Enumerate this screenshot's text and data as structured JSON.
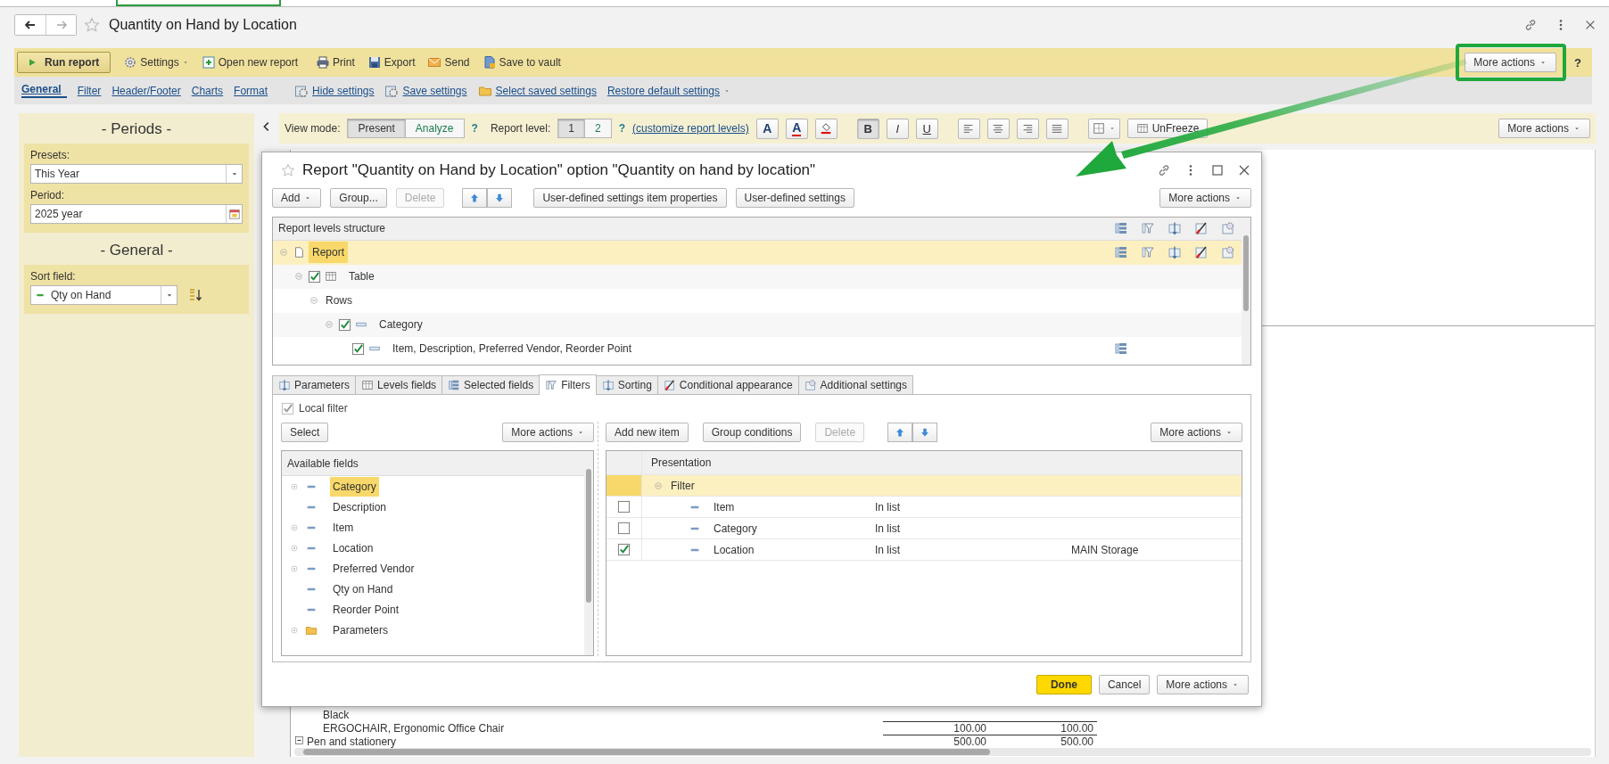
{
  "window": {
    "title": "Quantity on Hand by Location"
  },
  "command_bar": {
    "run_button": "Run report",
    "items": [
      {
        "label": "Settings",
        "dropdown": true
      },
      {
        "label": "Open new report",
        "dropdown": false
      },
      {
        "label": "Print",
        "dropdown": false
      },
      {
        "label": "Export",
        "dropdown": false
      },
      {
        "label": "Send",
        "dropdown": false
      },
      {
        "label": "Save to vault",
        "dropdown": false
      }
    ],
    "more_actions": {
      "label": "More actions",
      "highlighted": true
    },
    "help": "?"
  },
  "settings_bar": {
    "tabs": [
      {
        "label": "General",
        "selected": true
      },
      {
        "label": "Filter",
        "selected": false
      },
      {
        "label": "Header/Footer",
        "selected": false
      },
      {
        "label": "Charts",
        "selected": false
      },
      {
        "label": "Format",
        "selected": false
      }
    ],
    "links": [
      {
        "label": "Hide settings",
        "dropdown": false
      },
      {
        "label": "Save settings",
        "dropdown": false
      },
      {
        "label": "Select saved settings",
        "dropdown": false
      },
      {
        "label": "Restore default settings",
        "dropdown": true
      }
    ]
  },
  "settings_panel": {
    "sections": [
      {
        "title": "- Periods -",
        "fields": [
          {
            "kind": "select",
            "label": "Presets:",
            "value": "This Year"
          },
          {
            "kind": "date",
            "label": "Period:",
            "value": "2025 year"
          }
        ]
      },
      {
        "title": "- General -",
        "fields": [
          {
            "kind": "sort",
            "label": "Sort field:",
            "value": "Qty on Hand"
          }
        ]
      }
    ]
  },
  "report_toolbar": {
    "view_mode_label": "View mode:",
    "view_modes": [
      {
        "label": "Present",
        "selected": true
      },
      {
        "label": "Analyze",
        "selected": false
      }
    ],
    "view_mode_help": "?",
    "level_label": "Report level:",
    "levels": [
      {
        "label": "1",
        "selected": true
      },
      {
        "label": "2",
        "selected": false
      }
    ],
    "level_help": "?",
    "customize_link": "(customize report levels)",
    "font_buttons": [
      "A",
      "A"
    ],
    "style_buttons": [
      {
        "label": "B",
        "selected": true
      },
      {
        "label": "I",
        "selected": false
      },
      {
        "label": "U",
        "selected": false
      }
    ],
    "unfreeze": "UnFreeze",
    "more_actions": "More actions"
  },
  "report": {
    "rows": [
      {
        "kind": "text",
        "label": "Black"
      },
      {
        "kind": "item",
        "label": "ERGOCHAIR, Ergonomic Office Chair",
        "values": [
          "100.00",
          "100.00"
        ]
      },
      {
        "kind": "group",
        "label": "Pen and stationery",
        "values": [
          "500.00",
          "500.00"
        ]
      }
    ]
  },
  "dialog": {
    "title": "Report \"Quantity on Hand by Location\" option \"Quantity on hand by location\"",
    "buttons": [
      {
        "label": "Add",
        "dropdown": true,
        "disabled": false
      },
      {
        "label": "Group...",
        "dropdown": false,
        "disabled": false
      },
      {
        "label": "Delete",
        "dropdown": false,
        "disabled": true
      }
    ],
    "setting_buttons": [
      "User-defined settings item properties",
      "User-defined settings"
    ],
    "more_actions": "More actions",
    "structure": {
      "header": "Report levels structure",
      "items": [
        {
          "kind": "report",
          "label": "Report",
          "selected": true,
          "expanded": true,
          "children": [
            {
              "kind": "table",
              "label": "Table",
              "checked": true,
              "selected": false,
              "expanded": true,
              "children": [
                {
                  "kind": "rows",
                  "label": "Rows",
                  "selected": false,
                  "expanded": true,
                  "children": [
                    {
                      "kind": "group",
                      "label": "Category",
                      "checked": true,
                      "selected": false,
                      "expanded": true,
                      "children": [
                        {
                          "kind": "detail",
                          "label": "Item, Description, Preferred Vendor, Reorder Point",
                          "checked": true,
                          "selected": false
                        }
                      ]
                    }
                  ]
                }
              ]
            }
          ]
        }
      ]
    },
    "tabs": [
      {
        "label": "Parameters",
        "selected": false
      },
      {
        "label": "Levels fields",
        "selected": false
      },
      {
        "label": "Selected fields",
        "selected": false
      },
      {
        "label": "Filters",
        "selected": true
      },
      {
        "label": "Sorting",
        "selected": false
      },
      {
        "label": "Conditional appearance",
        "selected": false
      },
      {
        "label": "Additional settings",
        "selected": false
      }
    ],
    "local_filter": {
      "label": "Local filter",
      "checked": true
    },
    "select_button": "Select",
    "fields_more_actions": "More actions",
    "available_fields": {
      "header": "Available fields",
      "items": [
        {
          "kind": "field",
          "label": "Category",
          "expandable": true,
          "selected": true
        },
        {
          "kind": "field",
          "label": "Description",
          "expandable": false,
          "selected": false
        },
        {
          "kind": "field",
          "label": "Item",
          "expandable": true,
          "selected": false
        },
        {
          "kind": "field",
          "label": "Location",
          "expandable": true,
          "selected": false
        },
        {
          "kind": "field",
          "label": "Preferred Vendor",
          "expandable": true,
          "selected": false
        },
        {
          "kind": "field",
          "label": "Qty on Hand",
          "expandable": false,
          "selected": false
        },
        {
          "kind": "field",
          "label": "Reorder Point",
          "expandable": false,
          "selected": false
        },
        {
          "kind": "folder",
          "label": "Parameters",
          "expandable": true,
          "selected": false
        }
      ]
    },
    "filter_buttons": [
      {
        "label": "Add new item",
        "disabled": false
      },
      {
        "label": "Group conditions",
        "disabled": false
      },
      {
        "label": "Delete",
        "disabled": true
      }
    ],
    "filter_more_actions": "More actions",
    "filter_table": {
      "header": "Presentation",
      "rows": [
        {
          "kind": "group",
          "label": "Filter",
          "expanded": true,
          "selected": true
        },
        {
          "kind": "condition",
          "field": "Item",
          "condition": "In list",
          "checked": false,
          "selected": false
        },
        {
          "kind": "condition",
          "field": "Category",
          "condition": "In list",
          "checked": false,
          "selected": false
        },
        {
          "kind": "condition",
          "field": "Location",
          "condition": "In list",
          "value": "MAIN Storage",
          "checked": true,
          "selected": false
        }
      ]
    },
    "footer": [
      {
        "kind": "default",
        "label": "Done",
        "dropdown": false
      },
      {
        "kind": "normal",
        "label": "Cancel",
        "dropdown": false
      },
      {
        "kind": "normal",
        "label": "More actions",
        "dropdown": true
      }
    ]
  }
}
